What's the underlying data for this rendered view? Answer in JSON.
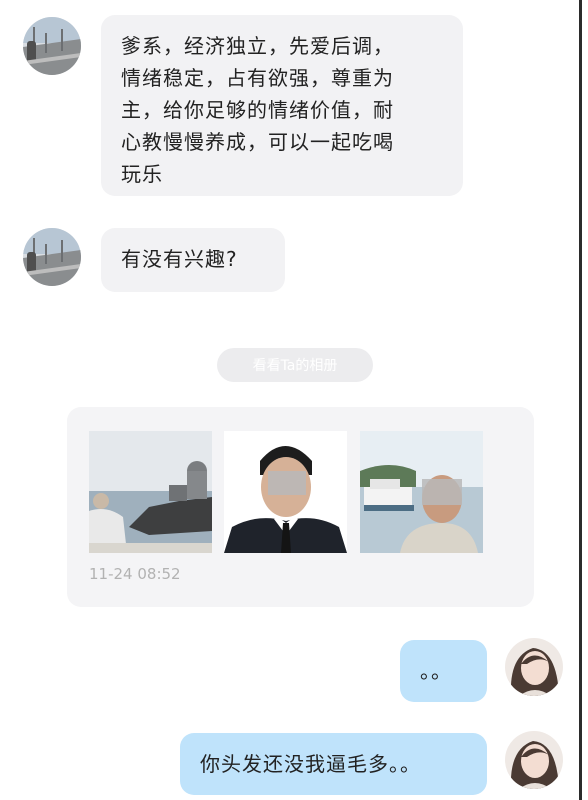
{
  "messages": [
    {
      "side": "incoming",
      "text": "爹系，经济独立，先爱后调，\n情绪稳定，占有欲强，尊重为\n主，给你足够的情绪价值，耐\n心教慢慢养成，可以一起吃喝\n玩乐"
    },
    {
      "side": "incoming",
      "text": "有没有兴趣?"
    },
    {
      "side": "outgoing",
      "text": "。。"
    },
    {
      "side": "outgoing",
      "text": "你头发还没我逼毛多。。"
    }
  ],
  "album": {
    "button_label": "看看Ta的相册",
    "photos": [
      {
        "subject": "man-at-seaside-photo"
      },
      {
        "subject": "man-in-suit-portrait-photo"
      },
      {
        "subject": "man-by-boat-photo"
      }
    ],
    "timestamp": "11-24 08:52"
  },
  "colors": {
    "incoming_bubble": "#f2f2f4",
    "outgoing_bubble": "#bfe3fb",
    "album_card": "#f4f4f6",
    "timestamp_text": "#b2b2b2"
  }
}
